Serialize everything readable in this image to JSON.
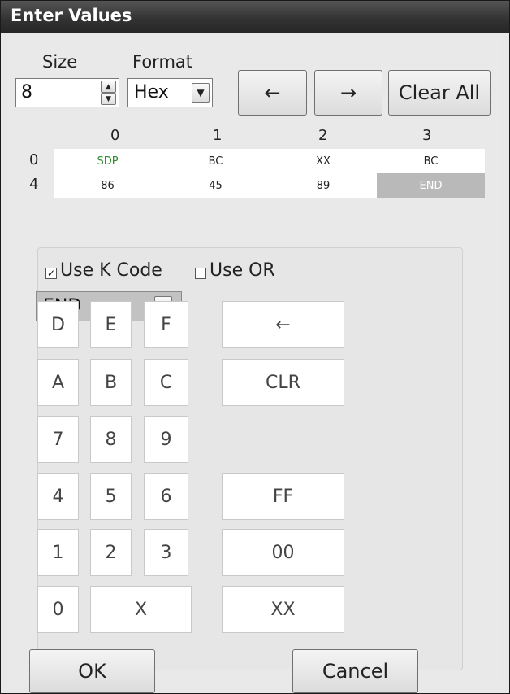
{
  "title": "Enter Values",
  "size": {
    "label": "Size",
    "value": "8"
  },
  "format": {
    "label": "Format",
    "value": "Hex"
  },
  "nav": {
    "left_arrow": "←",
    "right_arrow": "→",
    "clear_all": "Clear All"
  },
  "grid": {
    "columns": [
      "0",
      "1",
      "2",
      "3"
    ],
    "rows": [
      {
        "label": "0",
        "cells": [
          "SDP",
          "BC",
          "XX",
          "BC"
        ]
      },
      {
        "label": "4",
        "cells": [
          "86",
          "45",
          "89",
          "END"
        ]
      }
    ],
    "colors": {
      "sdp_text": "#2e8b2e",
      "selected_bg": "#b9b9b9",
      "selected_text": "#ffffff"
    }
  },
  "options": {
    "use_k_code": "Use K Code",
    "use_or": "Use OR",
    "use_k_code_checked": true,
    "use_or_checked": false
  },
  "kcode": {
    "value": "END"
  },
  "keypad": {
    "keys": [
      "D",
      "E",
      "F",
      "A",
      "B",
      "C",
      "7",
      "8",
      "9",
      "4",
      "5",
      "6",
      "1",
      "2",
      "3",
      "0",
      "X"
    ],
    "backspace": "←",
    "clr": "CLR",
    "ff": "FF",
    "zero_zero": "00",
    "xx": "XX"
  },
  "footer": {
    "ok": "OK",
    "cancel": "Cancel"
  }
}
